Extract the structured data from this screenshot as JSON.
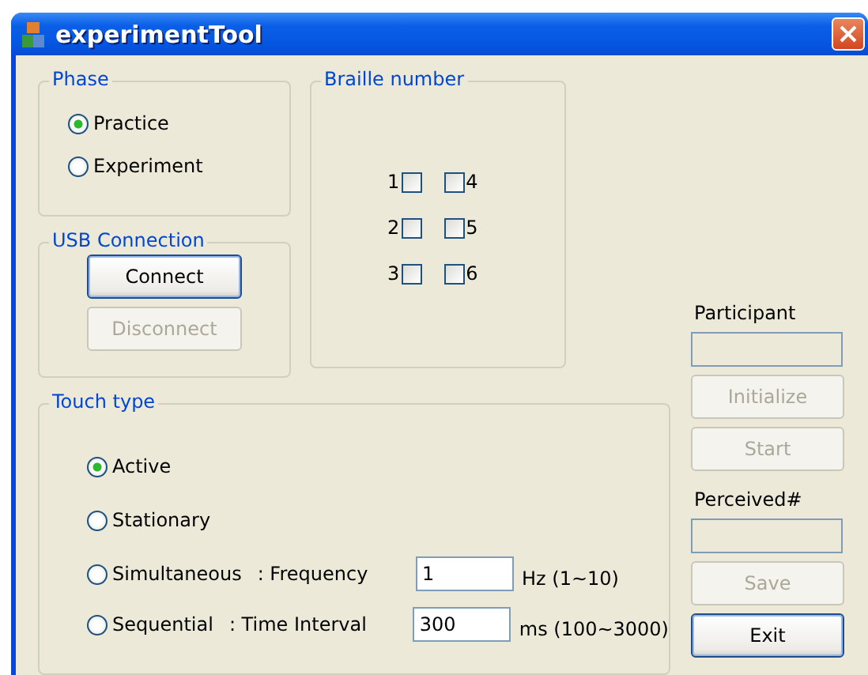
{
  "window": {
    "title": "experimentTool"
  },
  "phase": {
    "label": "Phase",
    "options": [
      {
        "label": "Practice",
        "selected": true
      },
      {
        "label": "Experiment",
        "selected": false
      }
    ]
  },
  "braille": {
    "label": "Braille number",
    "dots": [
      {
        "label": "1",
        "checked": false
      },
      {
        "label": "2",
        "checked": false
      },
      {
        "label": "3",
        "checked": false
      },
      {
        "label": "4",
        "checked": false
      },
      {
        "label": "5",
        "checked": false
      },
      {
        "label": "6",
        "checked": false
      }
    ]
  },
  "usb": {
    "label": "USB Connection",
    "buttons": [
      {
        "label": "Connect",
        "disabled": false,
        "default": true
      },
      {
        "label": "Disconnect",
        "disabled": true,
        "default": false
      }
    ]
  },
  "touch_type": {
    "label": "Touch type",
    "options": [
      {
        "label": "Active",
        "selected": true
      },
      {
        "label": "Stationary",
        "selected": false
      },
      {
        "label": "Simultaneous",
        "selected": false,
        "param": ": Frequency",
        "value": "1",
        "unit": "Hz (1~10)"
      },
      {
        "label": "Sequential",
        "selected": false,
        "param": ": Time Interval",
        "value": "300",
        "unit": "ms (100~3000)"
      }
    ]
  },
  "side": [
    {
      "kind": "label",
      "text": "Participant"
    },
    {
      "kind": "field"
    },
    {
      "kind": "button",
      "text": "Initialize",
      "disabled": true,
      "default": false
    },
    {
      "kind": "button",
      "text": "Start",
      "disabled": true,
      "default": false
    },
    {
      "kind": "label",
      "text": "Perceived#"
    },
    {
      "kind": "field"
    },
    {
      "kind": "button",
      "text": "Save",
      "disabled": true,
      "default": false
    },
    {
      "kind": "button",
      "text": "Exit",
      "disabled": false,
      "default": true
    }
  ]
}
